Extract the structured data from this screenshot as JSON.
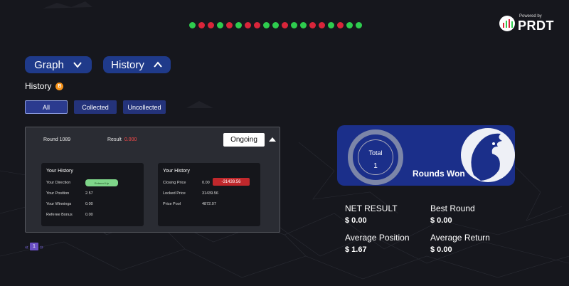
{
  "brand": {
    "powered": "Powered by",
    "name": "PRDT"
  },
  "streak": [
    "green",
    "red",
    "red",
    "green",
    "red",
    "green",
    "red",
    "red",
    "green",
    "green",
    "red",
    "green",
    "green",
    "red",
    "red",
    "green",
    "red",
    "green",
    "green"
  ],
  "colors": {
    "green": "#2ecc4e",
    "red": "#d9253a",
    "accent": "#1f3a8a"
  },
  "toolbar": {
    "graph_label": "Graph",
    "history_label": "History"
  },
  "history": {
    "title": "History",
    "coin_symbol": "B"
  },
  "filters": {
    "all": "All",
    "collected": "Collected",
    "uncollected": "Uncollected"
  },
  "round": {
    "title": "Round 1089",
    "result_label": "Result",
    "result_value": "0.000",
    "status": "Ongoing",
    "your_history": {
      "title": "Your History",
      "direction_label": "Your Direction",
      "direction_value": "Entered Up",
      "position_label": "Your Position",
      "position_value": "2.57",
      "winnings_label": "Your Winnings",
      "winnings_value": "0.00",
      "referee_label": "Referee Bonus",
      "referee_value": "0.00"
    },
    "price_history": {
      "title": "Your History",
      "closing_label": "Closing Price",
      "closing_value": "0.00",
      "closing_change": "-31439.56",
      "locked_label": "Locked Price",
      "locked_value": "31439.56",
      "pool_label": "Price Pool",
      "pool_value": "4872.07"
    }
  },
  "pager": {
    "prev": "«",
    "page": "1",
    "next": "»"
  },
  "rounds_won": {
    "total_label": "Total",
    "total_value": "1",
    "label": "Rounds Won"
  },
  "stats": {
    "net_result_label": "NET RESULT",
    "net_result_value": "$ 0.00",
    "best_round_label": "Best Round",
    "best_round_value": "$ 0.00",
    "avg_position_label": "Average Position",
    "avg_position_value": "$ 1.67",
    "avg_return_label": "Average Return",
    "avg_return_value": "$ 0.00"
  }
}
